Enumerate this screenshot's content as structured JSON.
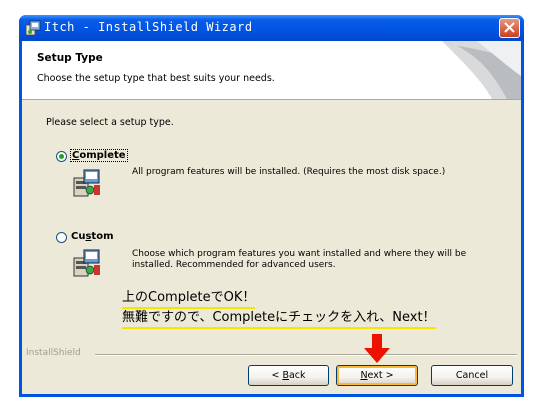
{
  "window": {
    "title": "Itch - InstallShield Wizard",
    "titlebar_color": "#0054e3",
    "close_icon": "close-icon"
  },
  "header": {
    "title": "Setup Type",
    "subtitle": "Choose the setup type that best suits your needs."
  },
  "prompt": "Please select a setup type.",
  "options": [
    {
      "label_mnemonic": "C",
      "label_rest": "omplete",
      "selected": true,
      "description": "All program features will be installed. (Requires the most disk space.)",
      "icon": "install-package-icon"
    },
    {
      "label_pre": "Cu",
      "label_mnemonic": "s",
      "label_rest": "tom",
      "selected": false,
      "description": "Choose which program features you want installed and where they will be installed. Recommended for advanced users.",
      "icon": "install-package-icon"
    }
  ],
  "annotation": {
    "line1": "上のCompleteでOK！",
    "line2": "無難ですので、Completeにチェックを入れ、Next！",
    "underline_color": "#f5e600",
    "arrow_color": "#ee1100"
  },
  "footer": {
    "brand": "InstallShield",
    "back_pre": "< ",
    "back_mnemonic": "B",
    "back_rest": "ack",
    "next_mnemonic": "N",
    "next_rest": "ext >",
    "cancel_label": "Cancel"
  }
}
